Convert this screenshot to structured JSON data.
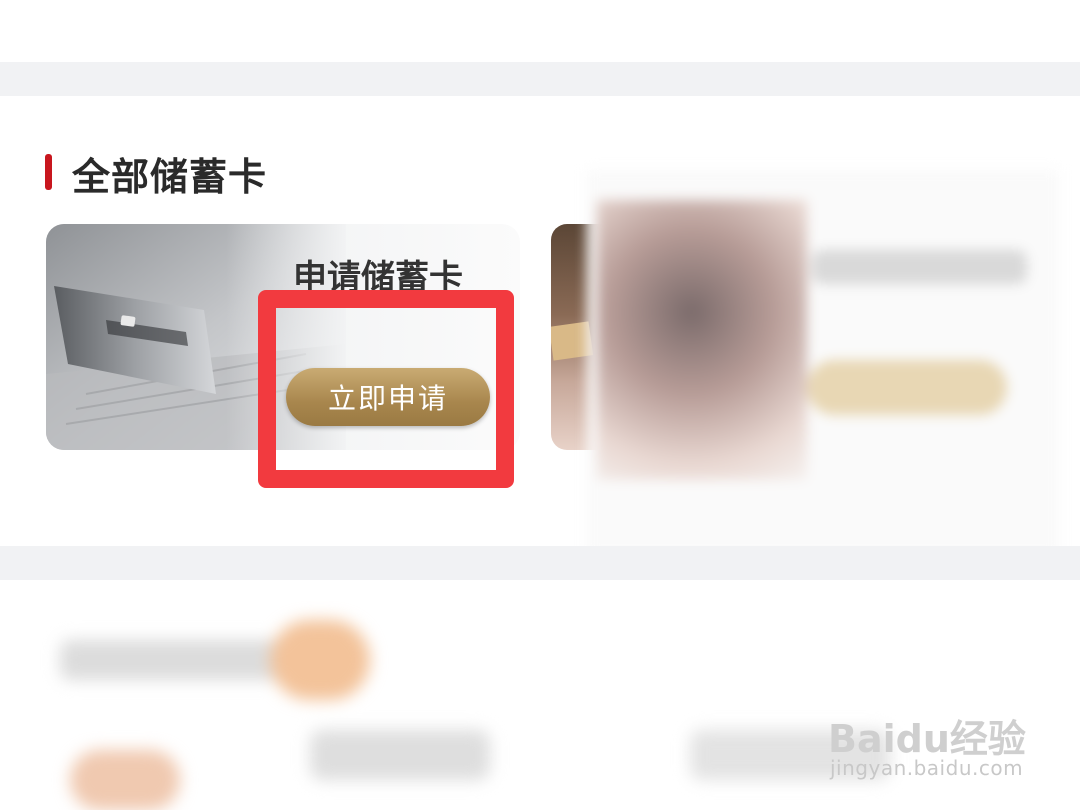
{
  "section": {
    "title": "全部储蓄卡"
  },
  "card": {
    "heading": "申请储蓄卡",
    "button_label": "立即申请"
  },
  "watermark": {
    "logo": "Baidu经验",
    "url": "jingyan.baidu.com"
  },
  "colors": {
    "accent_red": "#c8161e",
    "highlight_red": "#f23a3f",
    "button_gold": "#a8864d"
  }
}
